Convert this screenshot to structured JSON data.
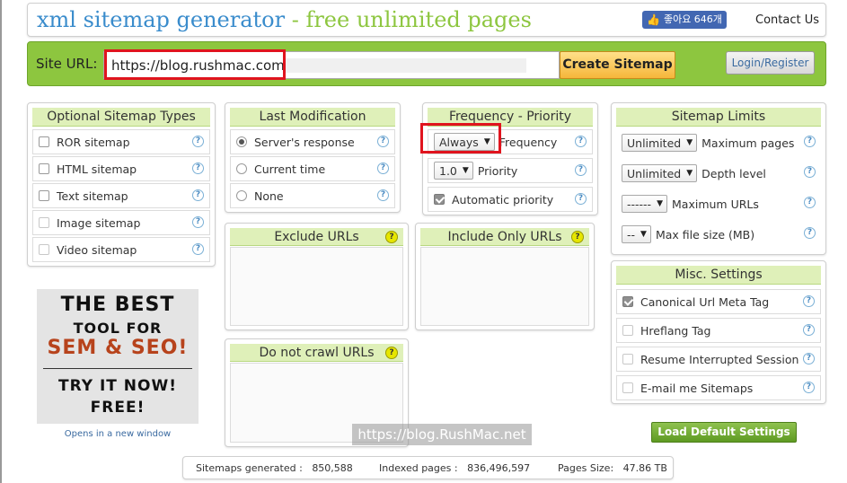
{
  "header": {
    "title_main": "xml sitemap generator",
    "title_dash": " - ",
    "title_sub": "free unlimited pages",
    "fb_like": "좋아요 646개",
    "contact": "Contact Us"
  },
  "site_bar": {
    "label": "Site URL:",
    "url_value": "https://blog.rushmac.com",
    "create_button": "Create Sitemap",
    "login_button": "Login/Register"
  },
  "optional_types": {
    "title": "Optional Sitemap Types",
    "items": [
      {
        "label": "ROR sitemap",
        "checked": false
      },
      {
        "label": "HTML sitemap",
        "checked": false
      },
      {
        "label": "Text sitemap",
        "checked": false
      },
      {
        "label": "Image sitemap",
        "checked": false
      },
      {
        "label": "Video sitemap",
        "checked": false
      }
    ]
  },
  "last_mod": {
    "title": "Last Modification",
    "items": [
      {
        "label": "Server's response",
        "selected": true
      },
      {
        "label": "Current time",
        "selected": false
      },
      {
        "label": "None",
        "selected": false
      }
    ]
  },
  "freq": {
    "title": "Frequency - Priority",
    "freq_select": "Always",
    "freq_label": "Frequency",
    "priority_select": "1.0",
    "priority_label": "Priority",
    "auto_label": "Automatic priority"
  },
  "limits": {
    "title": "Sitemap Limits",
    "rows": [
      {
        "select": "Unlimited",
        "label": "Maximum pages"
      },
      {
        "select": "Unlimited",
        "label": "Depth level"
      },
      {
        "select": "------",
        "label": "Maximum URLs"
      },
      {
        "select": "--",
        "label": "Max file size (MB)"
      }
    ]
  },
  "misc": {
    "title": "Misc. Settings",
    "items": [
      {
        "label": "Canonical Url Meta Tag",
        "checked": true
      },
      {
        "label": "Hreflang Tag",
        "checked": false
      },
      {
        "label": "Resume Interrupted Session",
        "checked": false
      },
      {
        "label": "E-mail me Sitemaps",
        "checked": false
      }
    ]
  },
  "exclude": {
    "title": "Exclude URLs"
  },
  "include": {
    "title": "Include Only URLs"
  },
  "nocrawl": {
    "title": "Do not crawl URLs"
  },
  "ad": {
    "line1": "THE BEST",
    "line2": "TOOL FOR",
    "line3": "SEM & SEO!",
    "line4": "TRY IT NOW!",
    "line5": "FREE!",
    "caption": "Opens in a new window"
  },
  "load_defaults": "Load Default Settings",
  "watermark": "https://blog.RushMac.net",
  "stats": {
    "generated_label": "Sitemaps generated :",
    "generated_value": "850,588",
    "indexed_label": "Indexed pages :",
    "indexed_value": "836,496,597",
    "size_label": "Pages Size:",
    "size_value": "47.86 TB"
  },
  "colors": {
    "accent_green": "#8dc63f",
    "title_blue": "#3a8ccc",
    "title_green": "#8dc63f",
    "highlight_red": "#e0141e"
  }
}
